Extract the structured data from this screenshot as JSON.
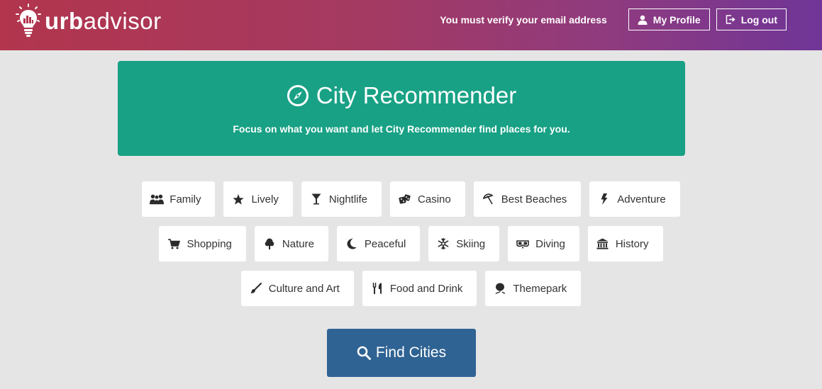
{
  "brand": {
    "name_bold": "urb",
    "name_rest": "advisor"
  },
  "nav": {
    "verify_message": "You must verify your email address",
    "profile_label": "My Profile",
    "logout_label": "Log out"
  },
  "header": {
    "title": "City Recommender",
    "subtitle": "Focus on what you want and let City Recommender find places for you."
  },
  "categories": [
    {
      "label": "Family",
      "icon": "family-icon"
    },
    {
      "label": "Lively",
      "icon": "star-icon"
    },
    {
      "label": "Nightlife",
      "icon": "cocktail-icon"
    },
    {
      "label": "Casino",
      "icon": "dice-icon"
    },
    {
      "label": "Best Beaches",
      "icon": "umbrella-icon"
    },
    {
      "label": "Adventure",
      "icon": "lightning-icon"
    },
    {
      "label": "Shopping",
      "icon": "cart-icon"
    },
    {
      "label": "Nature",
      "icon": "tree-icon"
    },
    {
      "label": "Peaceful",
      "icon": "moon-icon"
    },
    {
      "label": "Skiing",
      "icon": "snowflake-icon"
    },
    {
      "label": "Diving",
      "icon": "diving-mask-icon"
    },
    {
      "label": "History",
      "icon": "museum-icon"
    },
    {
      "label": "Culture and Art",
      "icon": "brush-icon"
    },
    {
      "label": "Food and Drink",
      "icon": "cutlery-icon"
    },
    {
      "label": "Themepark",
      "icon": "balloon-icon"
    }
  ],
  "find_button": {
    "label": "Find Cities"
  },
  "colors": {
    "navbar_gradient_start": "#b2354d",
    "navbar_gradient_end": "#6f3597",
    "jumbotron": "#18a185",
    "find_button": "#2f6393",
    "background": "#e5e5e5"
  }
}
